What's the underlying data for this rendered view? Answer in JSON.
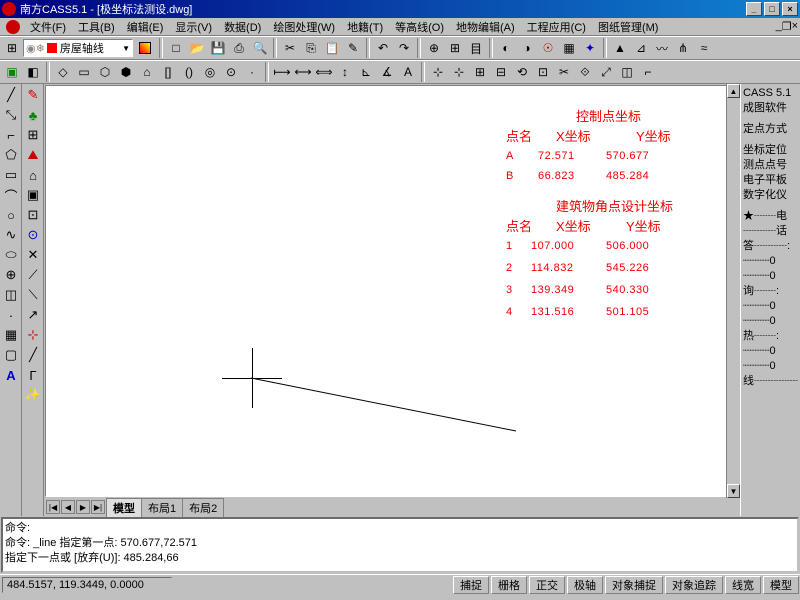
{
  "title": "南方CASS5.1 - [极坐标法测设.dwg]",
  "menu": [
    "文件(F)",
    "工具(B)",
    "编辑(E)",
    "显示(V)",
    "数据(D)",
    "绘图处理(W)",
    "地籍(T)",
    "等高线(O)",
    "地物编辑(A)",
    "工程应用(C)",
    "图纸管理(M)"
  ],
  "layer": "房屋轴线",
  "right": {
    "l1": "CASS 5.1",
    "l2": "成图软件",
    "l3": "定点方式",
    "l4": "坐标定位",
    "l5": "测点点号",
    "l6": "电子平板",
    "l7": "数字化仪",
    "l8": "★┈┈电",
    "l9": "┈┈┈话",
    "l10": "答┈┈┈:",
    "l11": "┈┈┈┈0",
    "l12": "┈┈┈┈0",
    "l13": "询┈┈:",
    "l14": "┈┈┈┈0",
    "l15": "┈┈┈┈0",
    "l16": "热┈┈:",
    "l17": "┈┈┈┈0",
    "l18": "┈┈┈┈0",
    "l19": "线┈┈┈┈"
  },
  "ctrl_title": "控制点坐标",
  "ctrl_hdr": {
    "a": "点名",
    "b": "X坐标",
    "c": "Y坐标"
  },
  "ctrl_rows": [
    {
      "n": "A",
      "x": "72.571",
      "y": "570.677"
    },
    {
      "n": "B",
      "x": "66.823",
      "y": "485.284"
    }
  ],
  "design_title": "建筑物角点设计坐标",
  "design_rows": [
    {
      "n": "1",
      "x": "107.000",
      "y": "506.000"
    },
    {
      "n": "2",
      "x": "114.832",
      "y": "545.226"
    },
    {
      "n": "3",
      "x": "139.349",
      "y": "540.330"
    },
    {
      "n": "4",
      "x": "131.516",
      "y": "501.105"
    }
  ],
  "tabs": {
    "t1": "模型",
    "t2": "布局1",
    "t3": "布局2"
  },
  "cmd": {
    "l1": "命令:",
    "l2": "命令: _line 指定第一点: 570.677,72.571",
    "l3": "指定下一点或 [放弃(U)]: 485.284,66"
  },
  "status": {
    "coords": "484.5157, 119.3449, 0.0000",
    "btns": [
      "捕捉",
      "栅格",
      "正交",
      "极轴",
      "对象捕捉",
      "对象追踪",
      "线宽",
      "模型"
    ]
  }
}
